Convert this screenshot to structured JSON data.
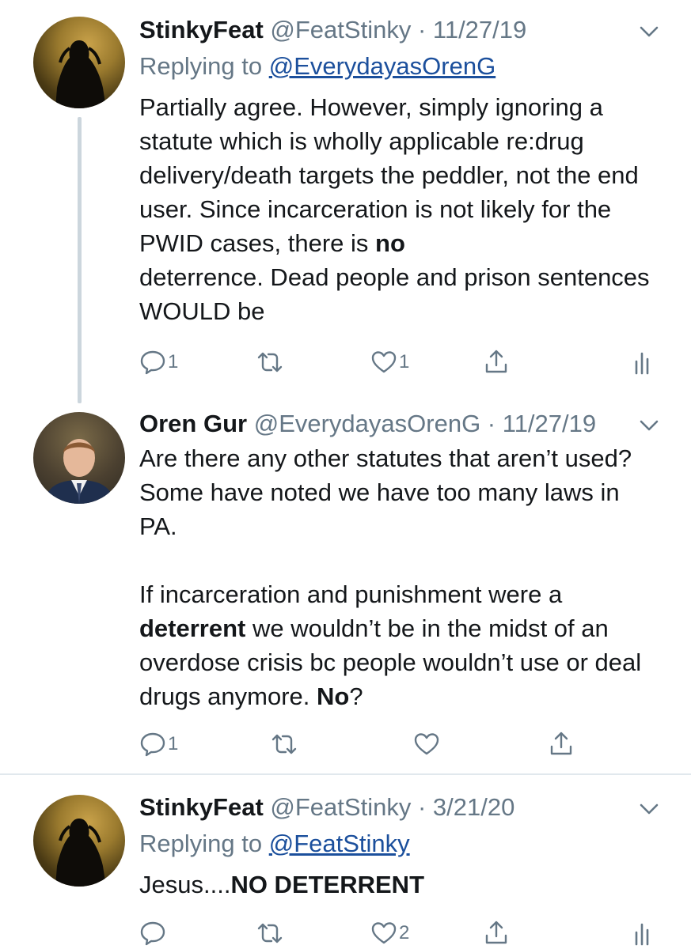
{
  "tweets": [
    {
      "name": "StinkyFeat",
      "handle": "@FeatStinky",
      "sep": " · ",
      "date": "11/27/19",
      "replying_prefix": "Replying to ",
      "replying_handle": "@EverydayasOrenG",
      "body_part1": "Partially agree. However, simply ignoring a statute which is wholly applicable re:drug delivery/death targets the peddler, not the end user. Since incarceration is not likely for the PWID cases, there is ",
      "body_bold1": "no",
      "body_part2": "\ndeterrence. Dead people and prison sentences WOULD be",
      "reply_count": "1",
      "like_count": "1"
    },
    {
      "name": "Oren Gur",
      "handle": "@EverydayasOrenG",
      "sep": " · ",
      "date": "11/27/19",
      "body_part1": "Are there any other statutes that aren’t used? Some have noted we have too many laws in PA.\n\nIf incarceration and punishment were a\n",
      "body_bold1": "deterrent",
      "body_part2": " we wouldn’t be in the midst of an overdose crisis bc people wouldn’t use or deal drugs anymore. ",
      "body_bold2": "No",
      "body_part3": "?",
      "reply_count": "1"
    },
    {
      "name": "StinkyFeat",
      "handle": "@FeatStinky",
      "sep": " · ",
      "date": "3/21/20",
      "replying_prefix": "Replying to ",
      "replying_handle": "@FeatStinky",
      "body_part1": "Jesus....",
      "body_bold1": "NO DETERRENT",
      "like_count": "2"
    }
  ],
  "icons": {
    "reply": "reply-icon",
    "retweet": "retweet-icon",
    "like": "heart-icon",
    "share": "share-icon",
    "analytics": "analytics-icon",
    "menu": "chevron-down-icon"
  },
  "colors": {
    "link": "#1b4f9c",
    "muted": "#657786",
    "text": "#14171a",
    "thread_line": "#ccd6dd"
  }
}
